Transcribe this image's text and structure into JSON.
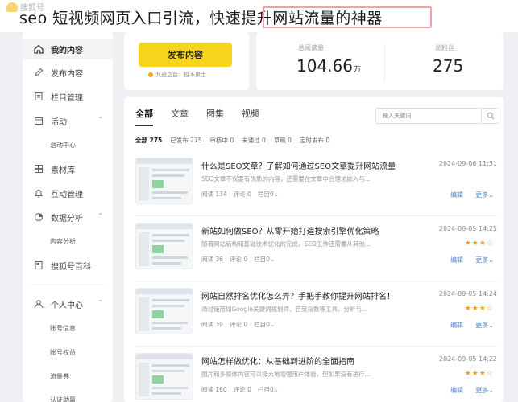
{
  "brand": {
    "logo_text": "搜狐号"
  },
  "headline": "seo 短视频网页入口引流，快速提升网站流量的神器",
  "sidebar": {
    "items": [
      {
        "label": "我的内容",
        "icon": "home-icon"
      },
      {
        "label": "发布内容",
        "icon": "pencil-icon"
      },
      {
        "label": "栏目管理",
        "icon": "document-icon"
      },
      {
        "label": "活动",
        "icon": "calendar-icon",
        "caret": "⌃"
      },
      {
        "label": "素材库",
        "icon": "grid-icon"
      },
      {
        "label": "互动管理",
        "icon": "bell-icon"
      },
      {
        "label": "数据分析",
        "icon": "chart-circle-icon",
        "caret": "⌃"
      },
      {
        "label": "搜狐号百科",
        "icon": "book-icon"
      },
      {
        "label": "个人中心",
        "icon": "user-icon",
        "caret": "⌃"
      }
    ],
    "sub_items": {
      "activity_center": "活动中心",
      "content_analysis": "内容分析",
      "account_info": "账号信息",
      "account_rights": "账号权益",
      "traffic_coupon": "流量券",
      "verify": "认证助赢"
    }
  },
  "publish": {
    "button_label": "发布内容",
    "hint": "九冠之台、但不累士"
  },
  "stats": [
    {
      "label": "总阅读量",
      "value": "104.66",
      "unit": "万"
    },
    {
      "label": "总粉丝",
      "value": "275",
      "unit": ""
    }
  ],
  "tabs": [
    "全部",
    "文章",
    "图集",
    "视频"
  ],
  "search": {
    "placeholder": "输入关键词"
  },
  "filters": [
    "全部 275",
    "已发布 275",
    "审核中 0",
    "未通过 0",
    "草稿 0",
    "定时发布 0"
  ],
  "articles": [
    {
      "title": "什么是SEO文章？了解如何通过SEO文章提升网站流量",
      "date": "2024-09-06 11:31",
      "summary": "SEO文章不仅要有优质的内容，还需要在文章中合理地嵌入与...",
      "reads": "阅读 134",
      "comments": "评论 0",
      "column": "栏目0",
      "stars": "",
      "edit": "编辑",
      "more": "更多"
    },
    {
      "title": "新站如何做SEO？从零开始打造搜索引擎优化策略",
      "date": "2024-09-05 14:25",
      "summary": "随着网站结构和基础技术优化的完成，SEO工作还需要从其他...",
      "reads": "阅读 36",
      "comments": "评论 0",
      "column": "栏目0",
      "stars": "★★★☆",
      "edit": "编辑",
      "more": "更多"
    },
    {
      "title": "网站自然排名优化怎么弄？手把手教你提升网站排名！",
      "date": "2024-09-05 14:24",
      "summary": "通过使用如Google关键词规划师、百度指数等工具，分析与...",
      "reads": "阅读 39",
      "comments": "评论 0",
      "column": "栏目0",
      "stars": "★★★☆",
      "edit": "编辑",
      "more": "更多"
    },
    {
      "title": "网站怎样做优化：从基础到进阶的全面指南",
      "date": "2024-09-05 14:22",
      "summary": "图片和多媒体内容可以极大地增强用户体验，但如果没有进行...",
      "reads": "阅读 160",
      "comments": "评论 0",
      "column": "栏目0",
      "stars": "★★★☆",
      "edit": "编辑",
      "more": "更多"
    }
  ],
  "colors": {
    "accent": "#f7d51d",
    "link": "#4a7fc1",
    "star": "#f0a020",
    "highlight_box": "#f0a3a3"
  }
}
